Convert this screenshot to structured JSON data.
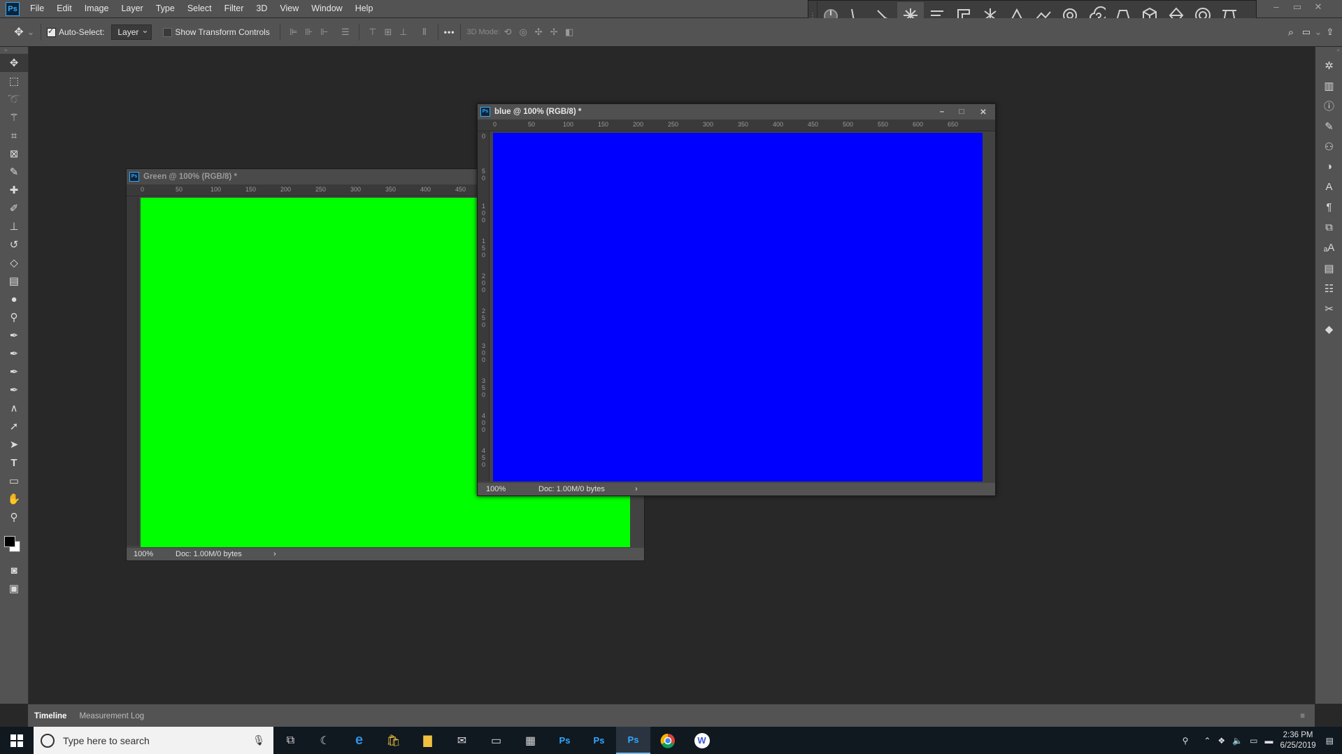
{
  "menu": [
    "File",
    "Edit",
    "Image",
    "Layer",
    "Type",
    "Select",
    "Filter",
    "3D",
    "View",
    "Window",
    "Help"
  ],
  "app_logo": "Ps",
  "options": {
    "auto_select_label": "Auto-Select:",
    "layer_select": "Layer",
    "show_transform_label": "Show Transform Controls",
    "mode3d_label": "3D Mode:",
    "more": "•••"
  },
  "doc_green": {
    "title": "Green @ 100% (RGB/8) *",
    "zoom": "100%",
    "doc_info": "Doc: 1.00M/0 bytes",
    "ruler_h": [
      "0",
      "50",
      "100",
      "150",
      "200",
      "250",
      "300",
      "350",
      "400",
      "450"
    ],
    "color": "#00ff00"
  },
  "doc_blue": {
    "title": "blue @ 100% (RGB/8) *",
    "zoom": "100%",
    "doc_info": "Doc: 1.00M/0 bytes",
    "ruler_h": [
      "0",
      "50",
      "100",
      "150",
      "200",
      "250",
      "300",
      "350",
      "400",
      "450",
      "500",
      "550",
      "600",
      "650"
    ],
    "ruler_v": [
      "0",
      "5 0",
      "1 0 0",
      "1 5 0",
      "2 0 0",
      "2 5 0",
      "3 0 0",
      "3 5 0",
      "4 0 0",
      "4 5 0"
    ],
    "color": "#0000ff"
  },
  "bottom_tabs": [
    "Timeline",
    "Measurement Log"
  ],
  "taskbar": {
    "search_placeholder": "Type here to search",
    "time": "2:36 PM",
    "date": "6/25/2019"
  }
}
